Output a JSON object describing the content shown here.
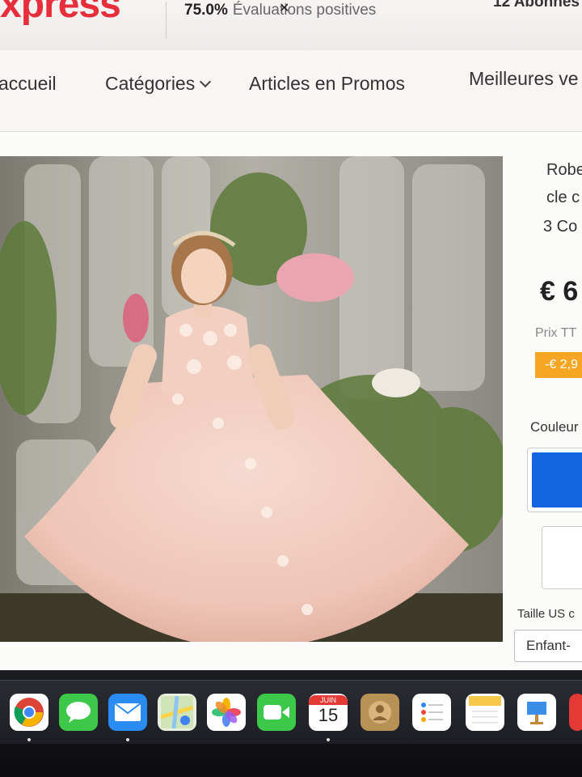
{
  "header": {
    "logo": "xpress",
    "rating_value": "75.0%",
    "rating_label": "Évaluations positives",
    "followers": "12 Abonnés"
  },
  "nav": {
    "items": [
      "accueil",
      "Catégories",
      "Articles en Promos",
      "Meilleures ve"
    ]
  },
  "product": {
    "title_line1": "Robe",
    "title_line2": "cle c",
    "commands": "3 Co",
    "price": "€ 6",
    "tt_label": "Prix TT",
    "discount": "-€ 2,9",
    "color_label": "Couleur",
    "size_label": "Taille US c",
    "size_value": "Enfant-"
  },
  "dock": {
    "calendar_month": "JUIN",
    "calendar_day": "15",
    "icons": [
      "chrome-icon",
      "messages-icon",
      "mail-icon",
      "maps-icon",
      "photos-icon",
      "facetime-icon",
      "calendar-icon",
      "contacts-icon",
      "reminders-icon",
      "notes-icon",
      "keynote-icon"
    ]
  },
  "colors": {
    "brand": "#e62e3c",
    "discount": "#f5a623",
    "swatch_blue": "#1565e0"
  }
}
